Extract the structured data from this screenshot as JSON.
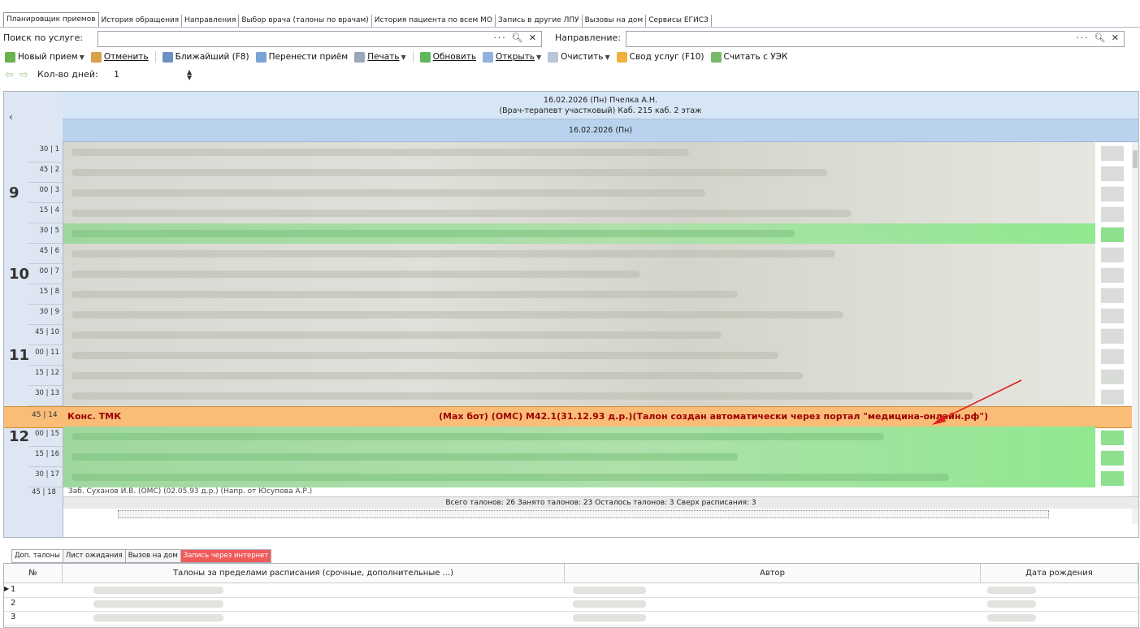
{
  "tabs": [
    "Планировщик приемов",
    "История обращения",
    "Направления",
    "Выбор врача (талоны по врачам)",
    "История пациента по всем МО",
    "Запись в другие ЛПУ",
    "Вызовы на дом",
    "Сервисы ЕГИСЗ"
  ],
  "search": {
    "service_label": "Поиск по услуге:",
    "direction_label": "Направление:"
  },
  "toolbar": {
    "new_appointment": "Новый прием",
    "cancel": "Отменить",
    "nearest": "Ближайший (F8)",
    "move": "Перенести приём",
    "print": "Печать",
    "refresh": "Обновить",
    "open": "Открыть",
    "clear": "Очистить",
    "services_summary": "Свод услуг (F10)",
    "read_uek": "Считать с УЭК"
  },
  "days": {
    "label": "Кол-во дней:",
    "value": "1"
  },
  "schedule": {
    "header_line1": "16.02.2026 (Пн) Пчелка А.Н.",
    "header_line2": "(Врач-терапевт участковый) Каб. 215 каб. 2 этаж",
    "date": "16.02.2026 (Пн)",
    "slots": [
      {
        "h": "",
        "m": "30",
        "n": "1"
      },
      {
        "h": "",
        "m": "45",
        "n": "2"
      },
      {
        "h": "9",
        "m": "00",
        "n": "3"
      },
      {
        "h": "",
        "m": "15",
        "n": "4"
      },
      {
        "h": "",
        "m": "30",
        "n": "5"
      },
      {
        "h": "",
        "m": "45",
        "n": "6"
      },
      {
        "h": "10",
        "m": "00",
        "n": "7"
      },
      {
        "h": "",
        "m": "15",
        "n": "8"
      },
      {
        "h": "",
        "m": "30",
        "n": "9"
      },
      {
        "h": "",
        "m": "45",
        "n": "10"
      },
      {
        "h": "11",
        "m": "00",
        "n": "11"
      },
      {
        "h": "",
        "m": "15",
        "n": "12"
      },
      {
        "h": "",
        "m": "30",
        "n": "13"
      }
    ],
    "highlight": {
      "time": "45 | 14",
      "prefix": "Конс. ТМК",
      "text": "(Max бот) (ОМС) М42.1(31.12.93 д.р.)(Талон создан автоматически через портал \"медицина-онлайн.рф\")"
    },
    "after_slots": [
      {
        "h": "12",
        "m": "00",
        "n": "15"
      },
      {
        "h": "",
        "m": "15",
        "n": "16"
      },
      {
        "h": "",
        "m": "30",
        "n": "17"
      }
    ],
    "slot18": {
      "time": "45 | 18",
      "text": "Заб. Суханов И.В. (ОМС) (02.05.93 д.р.) (Напр. от Юсупова А.Р.)"
    },
    "summary": "Всего талонов: 26  Занято талонов: 23  Осталось талонов: 3  Сверх расписания: 3"
  },
  "bottom_tabs": [
    "Доп. талоны",
    "Лист ожидания",
    "Вызов на дом",
    "Запись через интернет"
  ],
  "bottom_table": {
    "columns": [
      "№",
      "Талоны за пределами расписания (срочные, дополнительные ...)",
      "Автор",
      "Дата рождения"
    ],
    "rows": [
      "1",
      "2",
      "3"
    ]
  },
  "colors": {
    "highlight_bg": "#f9bd78",
    "highlight_text": "#9b0000",
    "booked_green": "#9fd89f",
    "tab_red": "#f05a5a"
  }
}
